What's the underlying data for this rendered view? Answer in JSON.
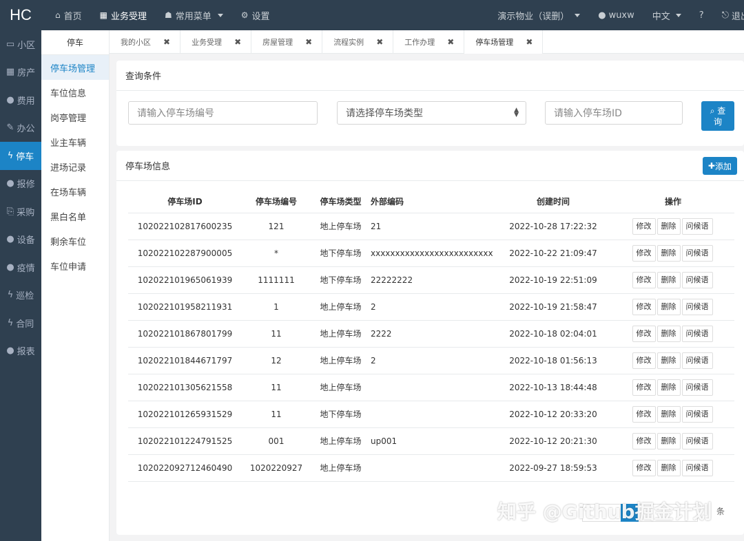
{
  "app": {
    "logo": "HC"
  },
  "topnav": [
    {
      "icon": "⌂",
      "label": "首页"
    },
    {
      "icon": "▦",
      "label": "业务受理"
    },
    {
      "icon": "☗",
      "label": "常用菜单"
    },
    {
      "icon": "⚙",
      "label": "设置"
    }
  ],
  "topright": {
    "community": "演示物业（误删）",
    "user": "wuxw",
    "lang": "中文",
    "help": "?",
    "logout": "退出"
  },
  "sidebar": [
    {
      "icon": "▭",
      "label": "小区"
    },
    {
      "icon": "▦",
      "label": "房产"
    },
    {
      "icon": "●",
      "label": "费用"
    },
    {
      "icon": "✎",
      "label": "办公"
    },
    {
      "icon": "ϟ",
      "label": "停车"
    },
    {
      "icon": "●",
      "label": "报修"
    },
    {
      "icon": "⎘",
      "label": "采购"
    },
    {
      "icon": "●",
      "label": "设备"
    },
    {
      "icon": "●",
      "label": "疫情"
    },
    {
      "icon": "ϟ",
      "label": "巡检"
    },
    {
      "icon": "ϟ",
      "label": "合同"
    },
    {
      "icon": "●",
      "label": "报表"
    }
  ],
  "submenu": {
    "title": "停车",
    "items": [
      "停车场管理",
      "车位信息",
      "岗亭管理",
      "业主车辆",
      "进场记录",
      "在场车辆",
      "黑白名单",
      "剩余车位",
      "车位申请"
    ]
  },
  "tabs": [
    "我的小区",
    "业务受理",
    "房屋管理",
    "流程实例",
    "工作办理",
    "停车场管理"
  ],
  "query": {
    "title": "查询条件",
    "num_placeholder": "请输入停车场编号",
    "type_select": "请选择停车场类型",
    "id_placeholder": "请输入停车场ID",
    "search_label_1": "查",
    "search_label_2": "询",
    "search_icon": "search-icon"
  },
  "info": {
    "title": "停车场信息",
    "add_label": "添加",
    "columns": [
      "停车场ID",
      "停车场编号",
      "停车场类型",
      "外部编码",
      "创建时间",
      "操作"
    ],
    "actions": [
      "修改",
      "删除",
      "问候语"
    ],
    "rows": [
      {
        "id": "102022102817600235",
        "num": "121",
        "type": "地上停车场",
        "ext": "21",
        "time": "2022-10-28 17:22:32"
      },
      {
        "id": "102022102287900005",
        "num": "*",
        "type": "地下停车场",
        "ext": "xxxxxxxxxxxxxxxxxxxxxxxxx",
        "time": "2022-10-22 21:09:47"
      },
      {
        "id": "102022101965061939",
        "num": "1111111",
        "type": "地下停车场",
        "ext": "22222222",
        "time": "2022-10-19 22:51:09"
      },
      {
        "id": "102022101958211931",
        "num": "1",
        "type": "地上停车场",
        "ext": "2",
        "time": "2022-10-19 21:58:47"
      },
      {
        "id": "102022101867801799",
        "num": "11",
        "type": "地上停车场",
        "ext": "2222",
        "time": "2022-10-18 02:04:01"
      },
      {
        "id": "102022101844671797",
        "num": "12",
        "type": "地上停车场",
        "ext": "2",
        "time": "2022-10-18 01:56:13"
      },
      {
        "id": "102022101305621558",
        "num": "11",
        "type": "地上停车场",
        "ext": "",
        "time": "2022-10-13 18:44:48"
      },
      {
        "id": "102022101265931529",
        "num": "11",
        "type": "地下停车场",
        "ext": "",
        "time": "2022-10-12 20:33:20"
      },
      {
        "id": "102022101224791525",
        "num": "001",
        "type": "地上停车场",
        "ext": "up001",
        "time": "2022-10-12 20:21:30"
      },
      {
        "id": "102022092712460490",
        "num": "1020220927",
        "type": "地上停车场",
        "ext": "",
        "time": "2022-09-27 18:59:53"
      }
    ]
  },
  "pager": {
    "tail": "条"
  },
  "watermark": "知乎 @Github掘金计划",
  "colors": {
    "sidebar_bg": "#2f4050",
    "accent": "#1c84c6"
  }
}
